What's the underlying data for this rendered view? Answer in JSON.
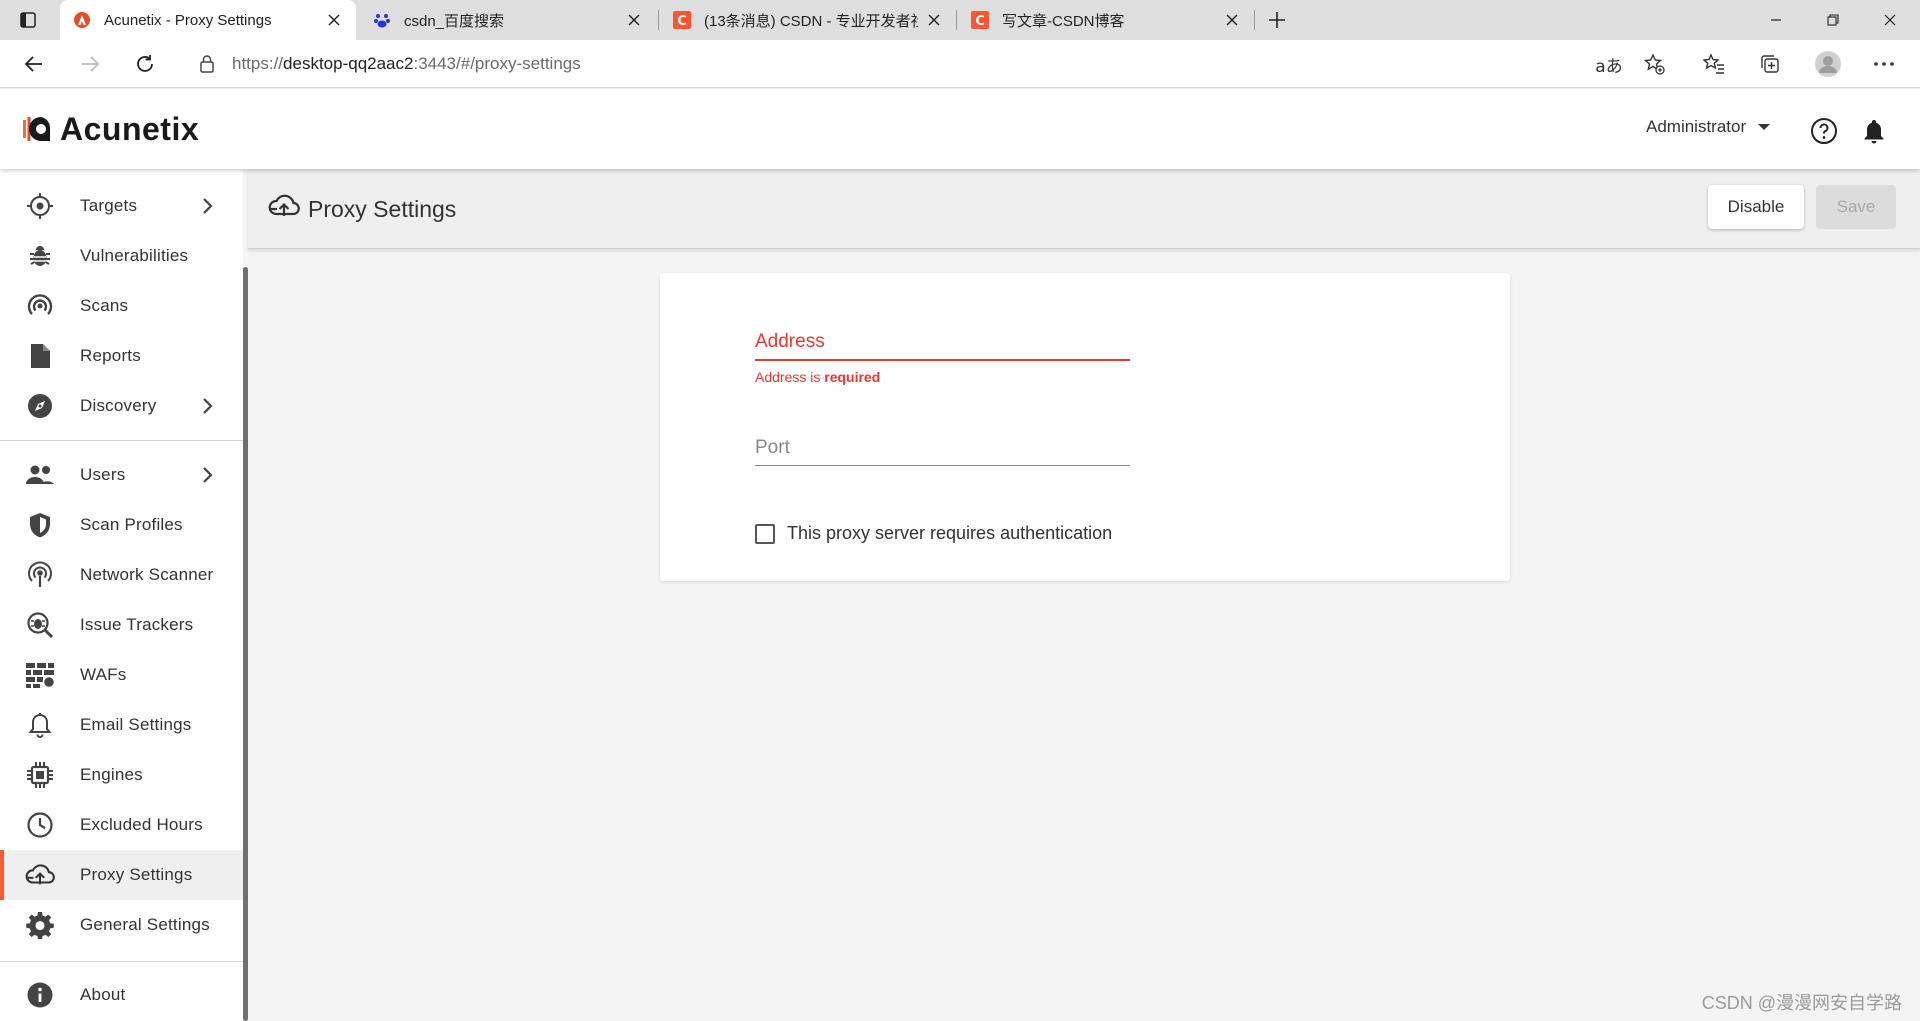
{
  "browser": {
    "tabs": [
      {
        "title": "Acunetix - Proxy Settings",
        "active": true
      },
      {
        "title": "csdn_百度搜索",
        "active": false
      },
      {
        "title": "(13条消息) CSDN - 专业开发者社",
        "active": false
      },
      {
        "title": "写文章-CSDN博客",
        "active": false
      }
    ],
    "url_prefix": "https://",
    "url_host": "desktop-qq2aac2",
    "url_rest": ":3443/#/proxy-settings"
  },
  "header": {
    "brand": "Acunetix",
    "user": "Administrator"
  },
  "sidebar": {
    "items": [
      {
        "label": "Targets",
        "icon": "target-icon"
      },
      {
        "label": "Vulnerabilities",
        "icon": "bug-icon"
      },
      {
        "label": "Scans",
        "icon": "scan-icon"
      },
      {
        "label": "Reports",
        "icon": "report-icon"
      },
      {
        "label": "Discovery",
        "icon": "compass-icon"
      },
      {
        "label": "Users",
        "icon": "users-icon"
      },
      {
        "label": "Scan Profiles",
        "icon": "shield-icon"
      },
      {
        "label": "Network Scanner",
        "icon": "network-icon"
      },
      {
        "label": "Issue Trackers",
        "icon": "bug-search-icon"
      },
      {
        "label": "WAFs",
        "icon": "firewall-icon"
      },
      {
        "label": "Email Settings",
        "icon": "bell-icon"
      },
      {
        "label": "Engines",
        "icon": "chip-icon"
      },
      {
        "label": "Excluded Hours",
        "icon": "clock-icon"
      },
      {
        "label": "Proxy Settings",
        "icon": "cloud-upload-icon"
      },
      {
        "label": "General Settings",
        "icon": "gear-icon"
      },
      {
        "label": "About",
        "icon": "info-icon"
      }
    ]
  },
  "page": {
    "title": "Proxy Settings",
    "disable_label": "Disable",
    "save_label": "Save"
  },
  "form": {
    "address_label": "Address",
    "address_error_prefix": "Address is",
    "address_error_strong": "required",
    "port_label": "Port",
    "auth_label": "This proxy server requires authentication"
  },
  "watermark": "CSDN @漫漫网安自学路",
  "colors": {
    "accent": "#ff5a2c",
    "error": "#e53935"
  }
}
